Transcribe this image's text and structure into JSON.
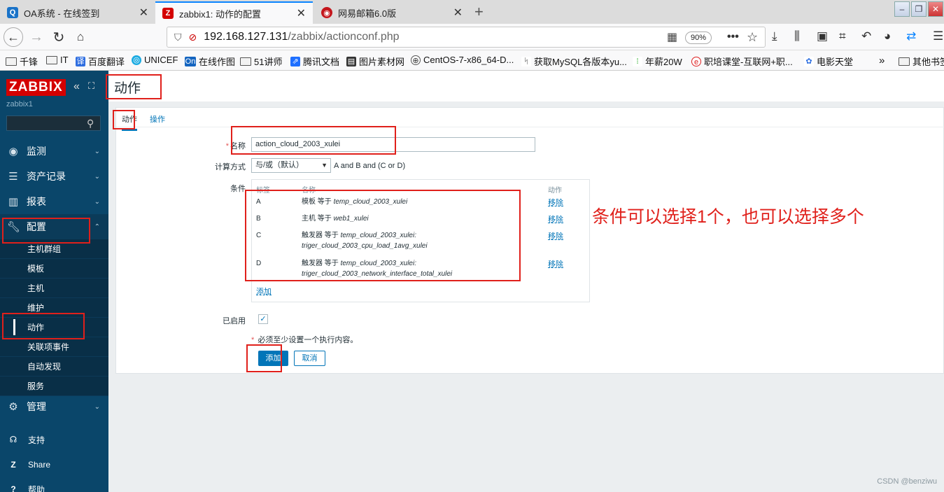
{
  "browser": {
    "tabs": [
      {
        "title": "OA系统 - 在线签到",
        "icon": "oa-icon",
        "active": false
      },
      {
        "title": "zabbix1: 动作的配置",
        "icon": "zabbix-icon",
        "active": true
      },
      {
        "title": "网易邮箱6.0版",
        "icon": "netease-mail-icon",
        "active": false
      }
    ],
    "url_host": "192.168.127.131",
    "url_path": "/zabbix/actionconf.php",
    "zoom": "90%",
    "bookmarks": [
      "千锋",
      "IT",
      "百度翻译",
      "UNICEF",
      "在线作图",
      "51讲师",
      "腾讯文档",
      "图片素材网",
      "CentOS-7-x86_64-D...",
      "获取MySQL各版本yu...",
      "年薪20W",
      "职培课堂-互联网+职...",
      "电影天堂",
      "其他书签"
    ]
  },
  "sidebar": {
    "logo": "ZABBIX",
    "server_name": "zabbix1",
    "menu": [
      {
        "label": "监测",
        "icon": "eye-icon"
      },
      {
        "label": "资产记录",
        "icon": "list-icon"
      },
      {
        "label": "报表",
        "icon": "chart-icon"
      },
      {
        "label": "配置",
        "icon": "wrench-icon"
      }
    ],
    "config_submenu": [
      "主机群组",
      "模板",
      "主机",
      "维护",
      "动作",
      "关联项事件",
      "自动发现",
      "服务"
    ],
    "admin": {
      "label": "管理",
      "icon": "gear-icon"
    },
    "support": "支持",
    "share": "Share",
    "help": "帮助"
  },
  "page": {
    "title": "动作",
    "tabs": [
      "动作",
      "操作"
    ],
    "form": {
      "name_label": "名称",
      "name_value": "action_cloud_2003_xulei",
      "calc_label": "计算方式",
      "calc_value": "与/或（默认）",
      "calc_formula": "A and B and (C or D)",
      "conditions_label": "条件",
      "conditions_headers": {
        "label": "标签",
        "name": "名称",
        "action": "动作"
      },
      "conditions": [
        {
          "label": "A",
          "prefix": "模板 等于 ",
          "value": "temp_cloud_2003_xulei",
          "value2": "",
          "action": "移除"
        },
        {
          "label": "B",
          "prefix": "主机 等于 ",
          "value": "web1_xulei",
          "value2": "",
          "action": "移除"
        },
        {
          "label": "C",
          "prefix": "触发器 等于 ",
          "value": "temp_cloud_2003_xulei:",
          "value2": "triger_cloud_2003_cpu_load_1avg_xulei",
          "action": "移除"
        },
        {
          "label": "D",
          "prefix": "触发器 等于 ",
          "value": "temp_cloud_2003_xulei:",
          "value2": "triger_cloud_2003_network_interface_total_xulei",
          "action": "移除"
        }
      ],
      "add_condition": "添加",
      "enabled_label": "已启用",
      "enabled": true,
      "note": "必须至少设置一个执行内容。",
      "submit": "添加",
      "cancel": "取消"
    }
  },
  "annotation": "条件可以选择1个，也可以选择多个",
  "watermark": "CSDN @benziwu",
  "colors": {
    "sidebar": "#0a466a",
    "accent": "#0275b8",
    "annotation": "#e0201b",
    "logo": "#d40000"
  }
}
